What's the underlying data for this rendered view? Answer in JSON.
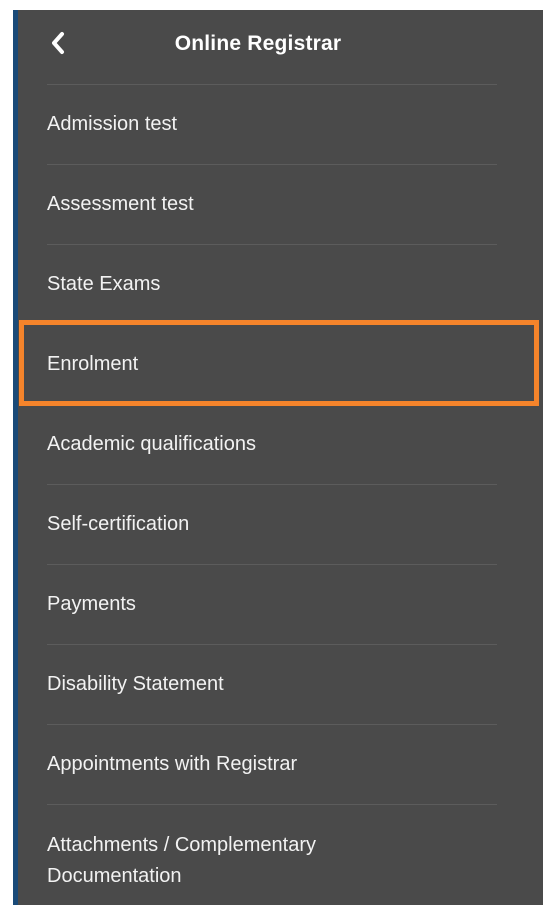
{
  "header": {
    "title": "Online Registrar",
    "back_icon": "chevron-left-icon"
  },
  "menu": {
    "items": [
      {
        "label": "Admission test"
      },
      {
        "label": "Assessment test"
      },
      {
        "label": "State Exams"
      },
      {
        "label": "Enrolment",
        "highlighted": true
      },
      {
        "label": "Academic qualifications"
      },
      {
        "label": "Self-certification"
      },
      {
        "label": "Payments"
      },
      {
        "label": "Disability Statement"
      },
      {
        "label": "Appointments with Registrar"
      },
      {
        "label": "Attachments / Complementary Documentation"
      }
    ]
  },
  "colors": {
    "panel_background": "#4a4a4a",
    "left_accent": "#1a4a78",
    "highlight_border": "#f5842b",
    "text": "#f2f2f2"
  }
}
